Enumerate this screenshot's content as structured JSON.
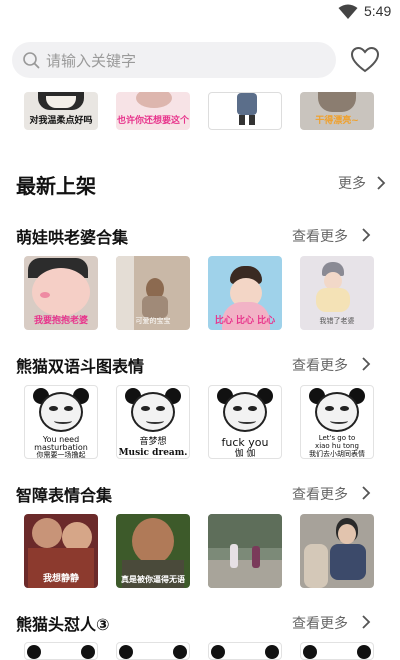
{
  "status": {
    "time": "5:49"
  },
  "search": {
    "placeholder": "请输入关键字"
  },
  "top_row": {
    "captions": [
      "对我温柔点好吗",
      "也许你还想要这个",
      "",
      "干得漂亮~"
    ]
  },
  "new_arrivals": {
    "title": "最新上架",
    "more": "更多"
  },
  "sections": [
    {
      "title": "萌娃哄老婆合集",
      "more": "查看更多",
      "captions": [
        "我要抱抱老婆",
        "可爱的宝宝",
        "比心 比心 比心",
        "我错了老婆"
      ]
    },
    {
      "title": "熊猫双语斗图表情",
      "more": "查看更多",
      "captions": [
        [
          "You need",
          "masturbation",
          "你需要一场撸起"
        ],
        [
          "音梦想",
          "Music dream."
        ],
        [
          "fuck you",
          "伽 伽"
        ],
        [
          "Let's go to",
          "xiao  hu  tong",
          "我们去小胡同表情"
        ]
      ]
    },
    {
      "title": "智障表情合集",
      "more": "查看更多",
      "captions": [
        "我想静静",
        "真是被你逼得无语",
        "",
        ""
      ]
    },
    {
      "title": "熊猫头怼人③",
      "more": "查看更多"
    }
  ],
  "colors": {
    "accent_pink": "#e8348c",
    "search_bg": "#f1f1f3",
    "text_gray": "#666666"
  }
}
